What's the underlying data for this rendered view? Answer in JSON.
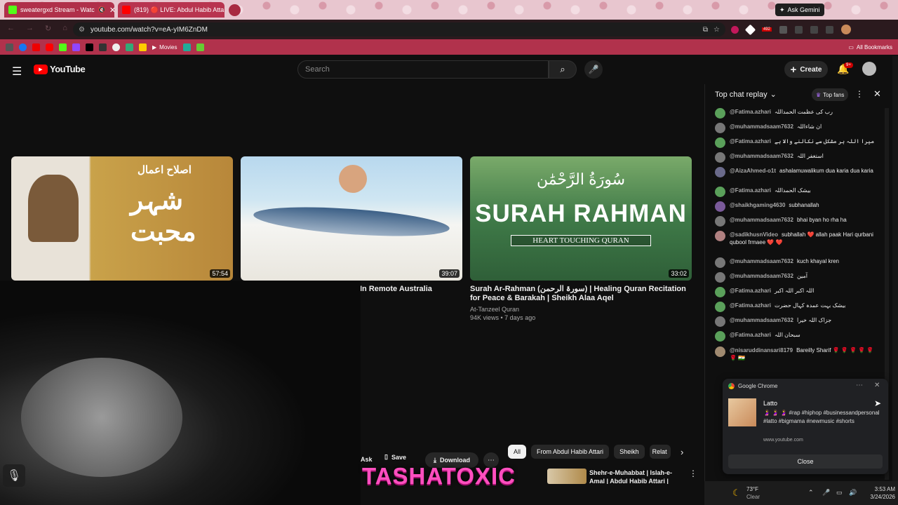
{
  "browser": {
    "tabs": [
      {
        "title": "sweatergxd Stream - Watc",
        "muted": "🔇"
      },
      {
        "title": "(819) 🔴 LIVE: Abdul Habib Atta"
      }
    ],
    "ask_gemini": "Ask Gemini",
    "url": "youtube.com/watch?v=eA-yIM6ZnDM",
    "bookmarks_movies": "Movies",
    "all_bookmarks": "All Bookmarks",
    "ext_badge": "492"
  },
  "youtube": {
    "logo": "YouTube",
    "search_placeholder": "Search",
    "create_label": "Create",
    "notif_badge": "9+"
  },
  "videos": [
    {
      "duration": "57:54",
      "title": "",
      "channel": "",
      "meta": ""
    },
    {
      "duration": "39:07",
      "title": "In Remote Australia",
      "channel": "",
      "meta": ""
    },
    {
      "duration": "33:02",
      "title": "Surah Ar-Rahman (سورۃ الرحمن) | Healing Quran Recitation for Peace & Barakah | Sheikh Alaa Aqel",
      "channel": "At-Tanzeel Quran",
      "meta": "94K views • 7 days ago"
    }
  ],
  "thumb_text": {
    "t1_urdu": "شہر محبت",
    "t1_header": "اصلاح اعمال",
    "t3_title": "SURAH RAHMAN",
    "t3_sub": "HEART TOUCHING QURAN",
    "t3_arabic": "سُورَةُ الرَّحْمَٰن"
  },
  "actions": {
    "ask": "Ask",
    "save": "Save",
    "download": "Download"
  },
  "chips": [
    "All",
    "From Abdul Habib Attari",
    "Sheikh",
    "Relat"
  ],
  "side_video": {
    "title": "Shehr-e-Muhabbat | Islah-e-Amal | Abdul Habib Attari |"
  },
  "overlay_text": "TASHATOXIC",
  "chat": {
    "header": "Top chat replay",
    "top_fans": "Top fans",
    "messages": [
      {
        "author": "@Fatima.azhari",
        "text": "رب کی عظمت الحمداللہ",
        "color": "#5aa05a"
      },
      {
        "author": "@muhammadsaam7632",
        "text": "ان شاءاللہ",
        "color": "#777"
      },
      {
        "author": "@Fatima.azhari",
        "text": "میرا اللہ ہر مشکل سے نکالنے والا ہے",
        "color": "#5aa05a"
      },
      {
        "author": "@muhammadsaam7632",
        "text": "استغفر اللہ",
        "color": "#777"
      },
      {
        "author": "@AizaAhmed-o1t",
        "text": "ashalamuwalikum dua karia dua karia",
        "color": "#6a6a8a"
      },
      {
        "author": "@Fatima.azhari",
        "text": "بیشک الحمداللہ",
        "color": "#5aa05a"
      },
      {
        "author": "@shaikhgaming4630",
        "text": "subhanallah",
        "color": "#7a5a9a"
      },
      {
        "author": "@muhammadsaam7632",
        "text": "bhai byan ho rha ha",
        "color": "#777"
      },
      {
        "author": "@sadikhusnVideo",
        "text": "subhallah ❤️ allah paak Hari qurbani qubool frmaee ❤️ ❤️",
        "color": "#b08080"
      },
      {
        "author": "@muhammadsaam7632",
        "text": "kuch khayal kren",
        "color": "#777"
      },
      {
        "author": "@muhammadsaam7632",
        "text": "آمین",
        "color": "#777"
      },
      {
        "author": "@Fatima.azhari",
        "text": "اللہ اکبر اللہ اکبر",
        "color": "#5aa05a"
      },
      {
        "author": "@Fatima.azhari",
        "text": "بیشک بہت عمدہ کہال حضرت",
        "color": "#5aa05a"
      },
      {
        "author": "@muhammadsaam7632",
        "text": "جزاک اللہ خیرا",
        "color": "#777"
      },
      {
        "author": "@Fatima.azhari",
        "text": "سبحان اللہ",
        "color": "#5aa05a"
      },
      {
        "author": "@nisaruddinansari8179",
        "text": "Bareilly Sharif 🌹 🌹 🌹 🌹 🌹 🌹 🇮🇳",
        "color": "#a08a70"
      }
    ]
  },
  "notification": {
    "app": "Google Chrome",
    "title": "Latto",
    "body": "🤰 🤰 🤰 #rap #hiphop #businessandpersonal #latto #bigmama #newmusic #shorts",
    "site": "www.youtube.com",
    "close": "Close"
  },
  "taskbar": {
    "temp": "73°F",
    "weather": "Clear",
    "time": "3:53 AM",
    "date": "3/24/2026"
  }
}
